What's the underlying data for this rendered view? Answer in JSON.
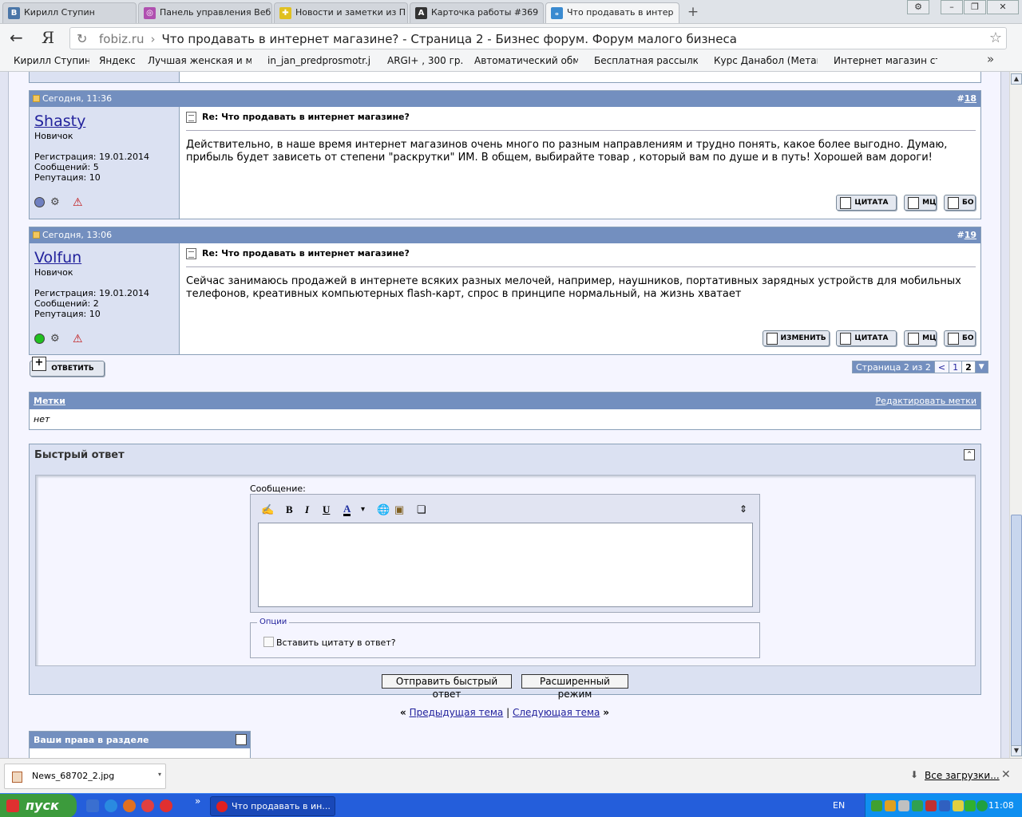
{
  "browser": {
    "tabs": [
      {
        "label": "Кирилл Ступин",
        "icon": "vk-icon",
        "color": "#4a76a8",
        "glyph": "В"
      },
      {
        "label": "Панель управления Веб",
        "icon": "target-icon",
        "color": "#b050b0",
        "glyph": "◎"
      },
      {
        "label": "Новости и заметки из П",
        "icon": "grid-icon",
        "color": "#e0c020",
        "glyph": "✚"
      },
      {
        "label": "Карточка работы #369",
        "icon": "letter-a-icon",
        "color": "#333333",
        "glyph": "A"
      },
      {
        "label": "Что продавать в интер",
        "icon": "forum-icon",
        "color": "#3a8ad0",
        "glyph": "ₒ"
      }
    ],
    "window_buttons": [
      "⚙",
      "–",
      "❐",
      "✕"
    ],
    "back_glyph": "←",
    "ya_glyph": "Я",
    "reload_glyph": "↻",
    "url_host": "fobiz.ru",
    "url_sep": "›",
    "page_title": "Что продавать в интернет магазине? - Страница 2 - Бизнес форум. Форум малого бизнеса",
    "star_glyph": "☆",
    "bookmarks": [
      "Кирилл Ступин",
      "Яндекс",
      "Лучшая женская и му",
      "in_jan_predprosmotr.j",
      "ARGI+ , 300 гр.",
      "Автоматический обме",
      "Бесплатная рассылка",
      "Курс Данабол (Метан",
      "Интернет магазин сте"
    ],
    "bookmarks_more": "»"
  },
  "posts": [
    {
      "date": "Сегодня, 11:36",
      "number_prefix": "#",
      "number": "18",
      "username": "Shasty",
      "user_title": "Новичок",
      "registration": "Регистрация: 19.01.2014",
      "messages": "Сообщений: 5",
      "reputation": "Репутация: 10",
      "status_color": "#7080c0",
      "title": "Re: Что продавать в интернет магазине?",
      "body": "Действительно, в наше время интернет магазинов очень много по разным направлениям и трудно понять, какое более выгодно. Думаю, прибыль будет зависеть от степени \"раскрутки\" ИМ. В общем, выбирайте товар , который вам по душе и в путь! Хорошей вам дороги!",
      "buttons": [
        "ЦИТАТА",
        "МЦ",
        "БО"
      ]
    },
    {
      "date": "Сегодня, 13:06",
      "number_prefix": "#",
      "number": "19",
      "username": "Volfun",
      "user_title": "Новичок",
      "registration": "Регистрация: 19.01.2014",
      "messages": "Сообщений: 2",
      "reputation": "Репутация: 10",
      "status_color": "#20c020",
      "title": "Re: Что продавать в интернет магазине?",
      "body": "Сейчас занимаюсь продажей в интернете всяких разных мелочей, например, наушников, портативных зарядных устройств для мобильных телефонов, креативных компьютерных flash-карт, спрос в принципе нормальный, на жизнь хватает",
      "buttons": [
        "ИЗМЕНИТЬ",
        "ЦИТАТА",
        "МЦ",
        "БО"
      ]
    }
  ],
  "user_icons": {
    "settings_glyph": "⚙",
    "warn_glyph": "⚠"
  },
  "reply_button": "ОТВЕТИТЬ",
  "pager": {
    "label": "Страница 2 из 2",
    "prev": "<",
    "pages": [
      "1"
    ],
    "current": "2",
    "dropdown": "▼"
  },
  "tags": {
    "header": "Метки",
    "edit": "Редактировать метки",
    "body": "нет"
  },
  "quick_reply": {
    "title": "Быстрый ответ",
    "collapse_glyph": "⌃",
    "message_label": "Сообщение:",
    "toolbar": [
      "✍",
      "B",
      "I",
      "U",
      "A",
      "▾",
      "🌐",
      "▣",
      "❏",
      "⇕"
    ],
    "options_legend": "Опции",
    "quote_checkbox": "Вставить цитату в ответ?",
    "quote_checked": false,
    "submit": "Отправить быстрый ответ",
    "advanced": "Расширенный режим"
  },
  "thread_nav": {
    "left": "«",
    "prev": "Предыдущая тема",
    "sep": "|",
    "next": "Следующая тема",
    "right": "»"
  },
  "rights": {
    "title": "Ваши права в разделе",
    "collapse_glyph": "⌃"
  },
  "scrollbar": {
    "up": "▲",
    "down": "▼"
  },
  "downloads": {
    "file": "News_68702_2.jpg",
    "arrow": "▾",
    "all_icon": "⬇",
    "all": "Все загрузки...",
    "close": "✕"
  },
  "taskbar": {
    "start": "пуск",
    "quicklaunch_colors": [
      "#3a6fd0",
      "#2a8ae0",
      "#e07020",
      "#e04040",
      "#e03030"
    ],
    "more": "»",
    "item": "Что продавать в ин...",
    "lang": "EN",
    "tray_colors": [
      "#40a030",
      "#e0a020",
      "#c0c0c0",
      "#30a050",
      "#c03030",
      "#3060c0",
      "#e0d040",
      "#30b030",
      "#20a040"
    ],
    "clock": "11:08"
  }
}
